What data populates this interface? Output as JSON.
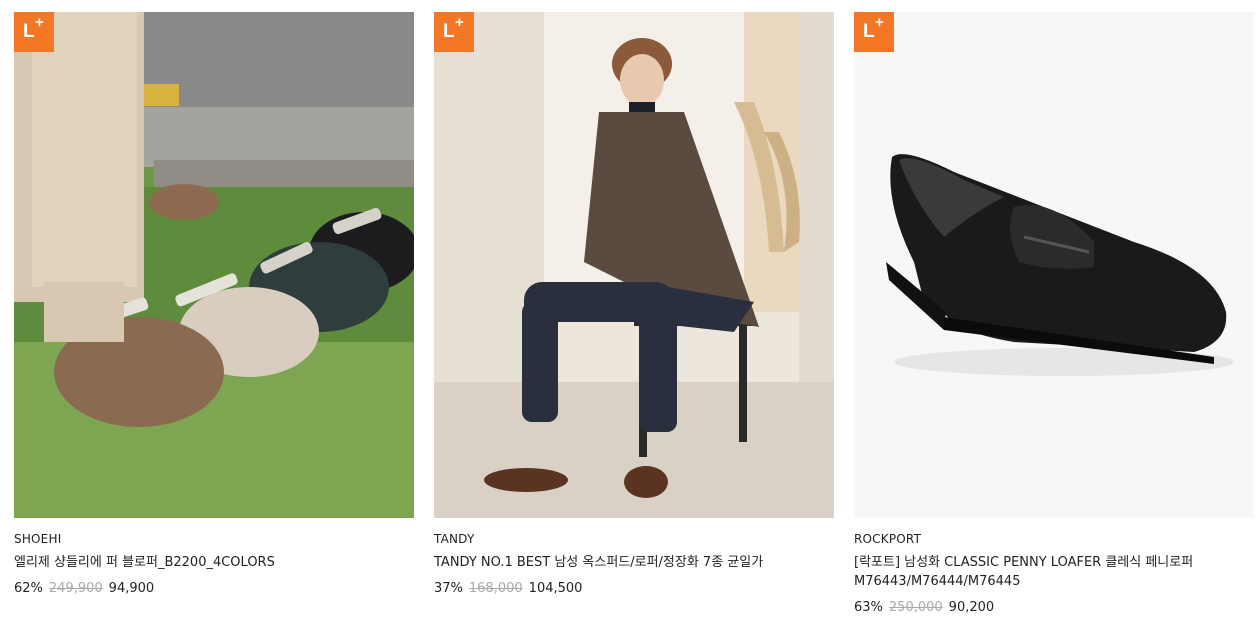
{
  "badge": {
    "letter": "L",
    "plus": "+"
  },
  "products": [
    {
      "brand": "SHOEHI",
      "title": "엘리제 샹들리에 퍼 블로퍼_B2200_4COLORS",
      "discount": "62%",
      "original_price": "249,900",
      "sale_price": "94,900"
    },
    {
      "brand": "TANDY",
      "title": "TANDY NO.1 BEST 남성 옥스퍼드/로퍼/정장화 7종 균일가",
      "discount": "37%",
      "original_price": "168,000",
      "sale_price": "104,500"
    },
    {
      "brand": "ROCKPORT",
      "title": "[락포트] 남성화 CLASSIC PENNY LOAFER 클레식 페니로퍼 M76443/M76444/M76445",
      "discount": "63%",
      "original_price": "250,000",
      "sale_price": "90,200"
    }
  ],
  "colors": {
    "badge": "#f47725",
    "strikethrough_text": "#aaaaaa"
  }
}
